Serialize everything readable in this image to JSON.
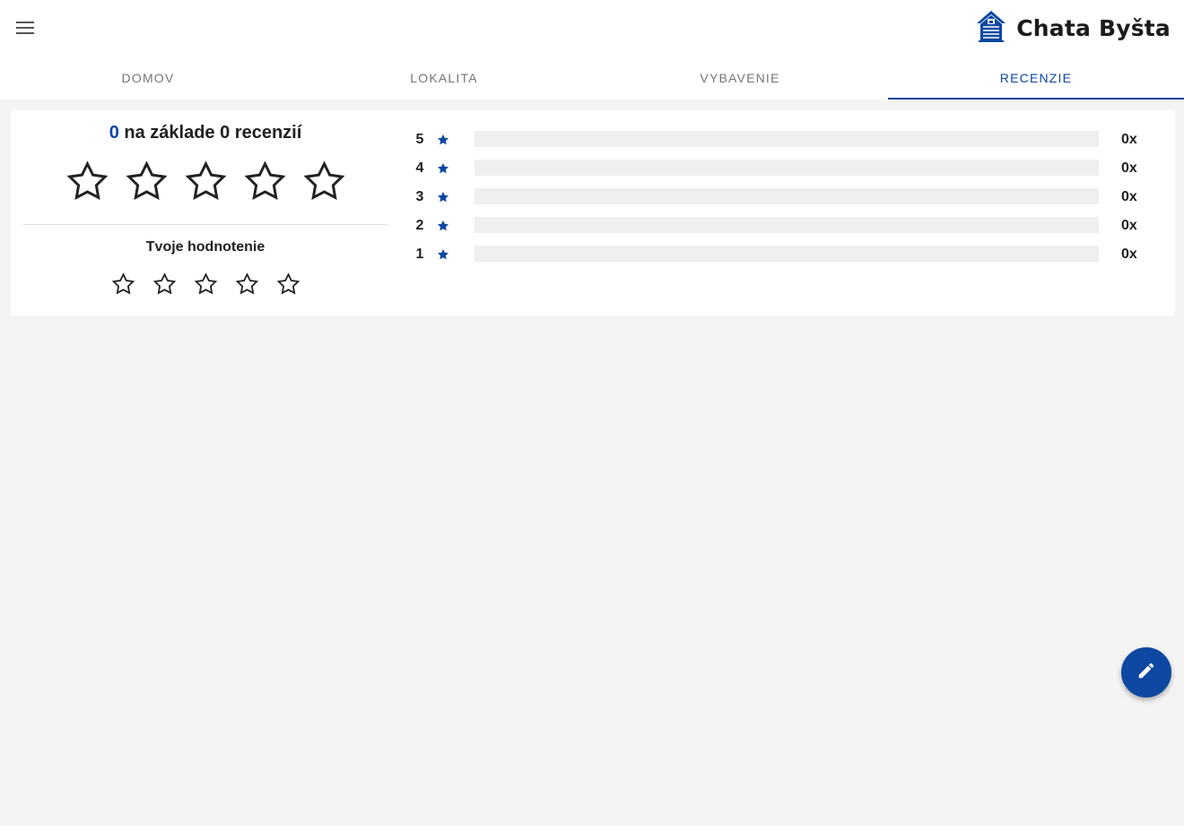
{
  "header": {
    "menu_icon": "hamburger-icon",
    "brand_name": "Chata Byšta",
    "logo_icon": "cabin-logo-icon"
  },
  "tabs": [
    {
      "label": "DOMOV",
      "active": false
    },
    {
      "label": "LOKALITA",
      "active": false
    },
    {
      "label": "VYBAVENIE",
      "active": false
    },
    {
      "label": "RECENZIE",
      "active": true
    }
  ],
  "reviews": {
    "average": "0",
    "summary_text": "na základe 0 recenzií",
    "average_stars": 0,
    "your_rating_title": "Tvoje hodnotenie",
    "your_rating": 0,
    "distribution": [
      {
        "stars": "5",
        "count": "0x",
        "fraction": 0
      },
      {
        "stars": "4",
        "count": "0x",
        "fraction": 0
      },
      {
        "stars": "3",
        "count": "0x",
        "fraction": 0
      },
      {
        "stars": "2",
        "count": "0x",
        "fraction": 0
      },
      {
        "stars": "1",
        "count": "0x",
        "fraction": 0
      }
    ]
  },
  "fab": {
    "icon": "pencil-icon"
  },
  "colors": {
    "accent": "#0d47a1",
    "background": "#f4f4f4",
    "bar_track": "#efefef"
  }
}
